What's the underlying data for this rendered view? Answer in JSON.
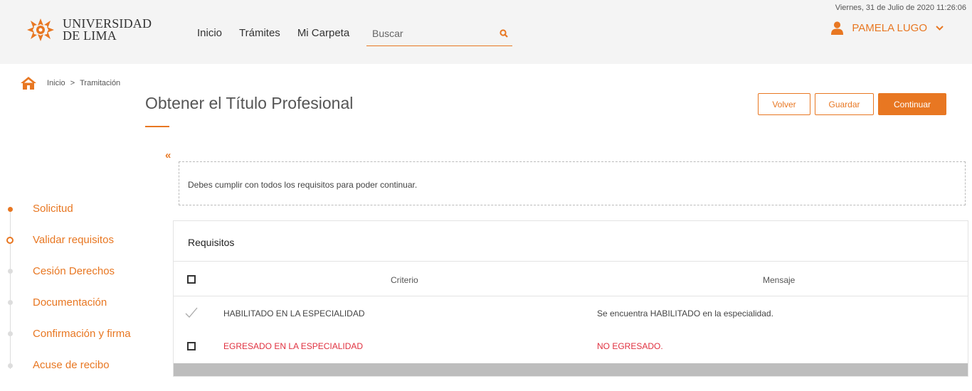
{
  "header": {
    "logo": {
      "line1": "UNIVERSIDAD",
      "line2": "DE LIMA"
    },
    "nav": [
      "Inicio",
      "Trámites",
      "Mi Carpeta"
    ],
    "search_placeholder": "Buscar",
    "date": "Viernes, 31 de Julio de 2020 11:26:06",
    "user": "PAMELA LUGO",
    "accent": "#e87722"
  },
  "breadcrumb": {
    "items": [
      "Inicio",
      "Tramitación"
    ],
    "separator": ">"
  },
  "page": {
    "title": "Obtener el Título Profesional",
    "buttons": {
      "volver": "Volver",
      "guardar": "Guardar",
      "continuar": "Continuar"
    },
    "collapse_label": "«"
  },
  "steps": [
    {
      "label": "Solicitud",
      "state": "done"
    },
    {
      "label": "Validar requisitos",
      "state": "current"
    },
    {
      "label": "Cesión Derechos",
      "state": "pending"
    },
    {
      "label": "Documentación",
      "state": "pending"
    },
    {
      "label": "Confirmación y firma",
      "state": "pending"
    },
    {
      "label": "Acuse de recibo",
      "state": "pending"
    }
  ],
  "notice": "Debes cumplir con todos los requisitos para poder continuar.",
  "requisitos": {
    "title": "Requisitos",
    "columns": {
      "criterio": "Criterio",
      "mensaje": "Mensaje"
    },
    "rows": [
      {
        "criterio": "HABILITADO EN LA ESPECIALIDAD",
        "mensaje": "Se encuentra HABILITADO en la especialidad.",
        "status": "ok"
      },
      {
        "criterio": "EGRESADO EN LA ESPECIALIDAD",
        "mensaje": "NO EGRESADO.",
        "status": "error",
        "color": "#e0303f"
      }
    ]
  }
}
